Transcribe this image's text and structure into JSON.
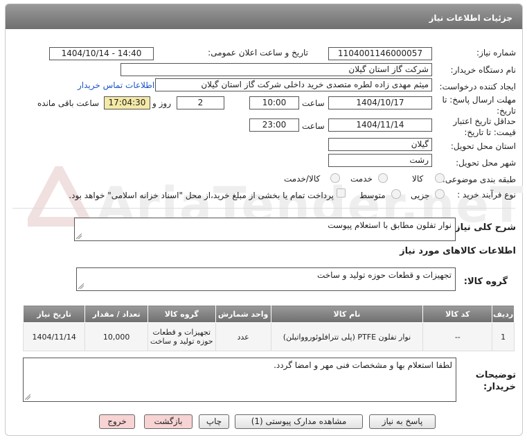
{
  "header": {
    "title": "جزئیات اطلاعات نیاز"
  },
  "watermark": {
    "text": "AriaTender.neT"
  },
  "fields": {
    "need_number_label": "شماره نیاز:",
    "need_number": "1104001146000057",
    "announce_label": "تاریخ و ساعت اعلان عمومی:",
    "announce_value": "1404/10/14 - 14:40",
    "buyer_label": "نام دستگاه خریدار:",
    "buyer_value": "شرکت گاز استان گیلان",
    "creator_label": "ایجاد کننده درخواست:",
    "creator_value": "میثم مهدی زاده لطره متصدی خرید داخلی  شرکت گاز استان گیلان",
    "contact_link": "اطلاعات تماس خریدار",
    "reply_label_1": "مهلت ارسال پاسخ: تا",
    "reply_label_2": "تاریخ:",
    "reply_date": "1404/10/17",
    "time_label": "ساعت",
    "reply_time": "10:00",
    "days_value": "2",
    "days_label": "روز و",
    "remaining_time": "17:04:30",
    "remaining_label": "ساعت باقی مانده",
    "validity_label_1": "حداقل تاریخ اعتبار",
    "validity_label_2": "قیمت: تا تاریخ:",
    "validity_date": "1404/11/14",
    "validity_time": "23:00",
    "province_label": "استان محل تحویل:",
    "province_value": "گیلان",
    "city_label": "شهر محل تحویل:",
    "city_value": "رشت",
    "category_label": "طبقه بندی موضوعی:",
    "category_options": [
      "کالا",
      "خدمت",
      "کالا/خدمت"
    ],
    "process_label": "نوع فرآیند خرید :",
    "process_options": [
      "جزیی",
      "متوسط"
    ],
    "payment_note": "پرداخت تمام یا بخشی از مبلغ خرید،از محل \"اسناد خزانه اسلامی\" خواهد بود.",
    "summary_label": "شرح کلی نیاز:",
    "summary_value": "نوار تفلون مطابق با استعلام پیوست",
    "goods_info_title": "اطلاعات کالاهای مورد نیاز",
    "goods_group_label": "گروه کالا:",
    "goods_group_value": "تجهیزات و قطعات حوزه تولید و ساخت",
    "notes_label_1": "توضیحات",
    "notes_label_2": "خریدار:",
    "notes_value": "لطفا استعلام بها و مشخصات فنی مهر و امضا گردد."
  },
  "table": {
    "headers": [
      "ردیف",
      "کد کالا",
      "نام کالا",
      "واحد شمارش",
      "گروه کالا",
      "تعداد / مقدار",
      "تاریخ نیاز"
    ],
    "rows": [
      [
        "1",
        "--",
        "نوار تفلون PTFE (پلی تترافلوئوروواتیلن)",
        "عدد",
        "تجهیزات و قطعات حوزه تولید و ساخت",
        "10,000",
        "1404/11/14"
      ]
    ]
  },
  "buttons": {
    "reply": "پاسخ به نیاز",
    "docs": "مشاهده مدارک پیوستی (1)",
    "print": "چاپ",
    "back": "بازگشت",
    "exit": "خروج"
  }
}
